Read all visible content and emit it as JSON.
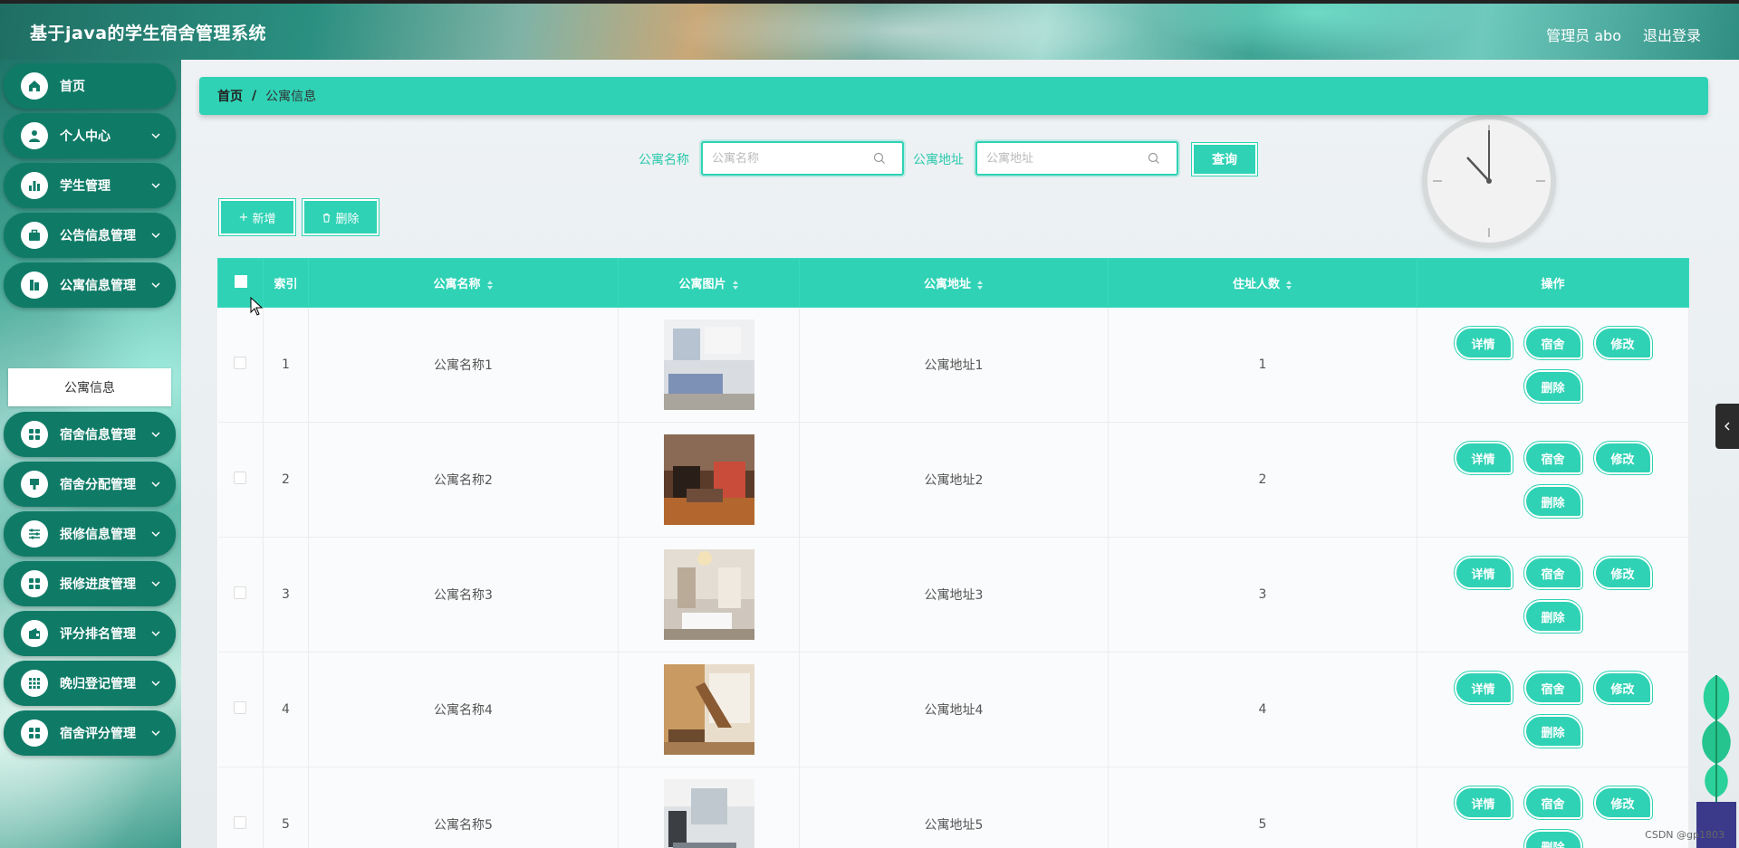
{
  "app": {
    "title": "基于java的学生宿舍管理系统",
    "user_label": "管理员 abo",
    "logout_label": "退出登录"
  },
  "colors": {
    "accent": "#2fd2b5",
    "menu_bg": "#0f7b67"
  },
  "sidebar": {
    "items": [
      {
        "label": "首页",
        "icon": "home-icon"
      },
      {
        "label": "个人中心",
        "icon": "user-icon"
      },
      {
        "label": "学生管理",
        "icon": "bar-chart-icon"
      },
      {
        "label": "公告信息管理",
        "icon": "briefcase-icon"
      },
      {
        "label": "公寓信息管理",
        "icon": "building-icon"
      },
      {
        "label": "宿舍信息管理",
        "icon": "grid-icon"
      },
      {
        "label": "宿舍分配管理",
        "icon": "stamp-icon"
      },
      {
        "label": "报修信息管理",
        "icon": "sliders-icon"
      },
      {
        "label": "报修进度管理",
        "icon": "grid-icon"
      },
      {
        "label": "评分排名管理",
        "icon": "wallet-icon"
      },
      {
        "label": "晚归登记管理",
        "icon": "apps-icon"
      },
      {
        "label": "宿舍评分管理",
        "icon": "grid-icon"
      }
    ],
    "submenu": {
      "label": "公寓信息"
    }
  },
  "breadcrumb": {
    "home": "首页",
    "separator": "/",
    "current": "公寓信息"
  },
  "search": {
    "name_label": "公寓名称",
    "name_placeholder": "公寓名称",
    "address_label": "公寓地址",
    "address_placeholder": "公寓地址",
    "query_label": "查询"
  },
  "toolbar": {
    "add_label": "新增",
    "delete_label": "删除"
  },
  "table": {
    "headers": {
      "index": "索引",
      "name": "公寓名称",
      "image": "公寓图片",
      "address": "公寓地址",
      "count": "住址人数",
      "ops": "操作"
    },
    "rows": [
      {
        "index": "1",
        "name": "公寓名称1",
        "address": "公寓地址1",
        "count": "1"
      },
      {
        "index": "2",
        "name": "公寓名称2",
        "address": "公寓地址2",
        "count": "2"
      },
      {
        "index": "3",
        "name": "公寓名称3",
        "address": "公寓地址3",
        "count": "3"
      },
      {
        "index": "4",
        "name": "公寓名称4",
        "address": "公寓地址4",
        "count": "4"
      },
      {
        "index": "5",
        "name": "公寓名称5",
        "address": "公寓地址5",
        "count": "5"
      }
    ],
    "row_actions": {
      "detail": "详情",
      "dorm": "宿舍",
      "edit": "修改",
      "delete": "删除"
    }
  },
  "watermark": "CSDN @gp1803"
}
